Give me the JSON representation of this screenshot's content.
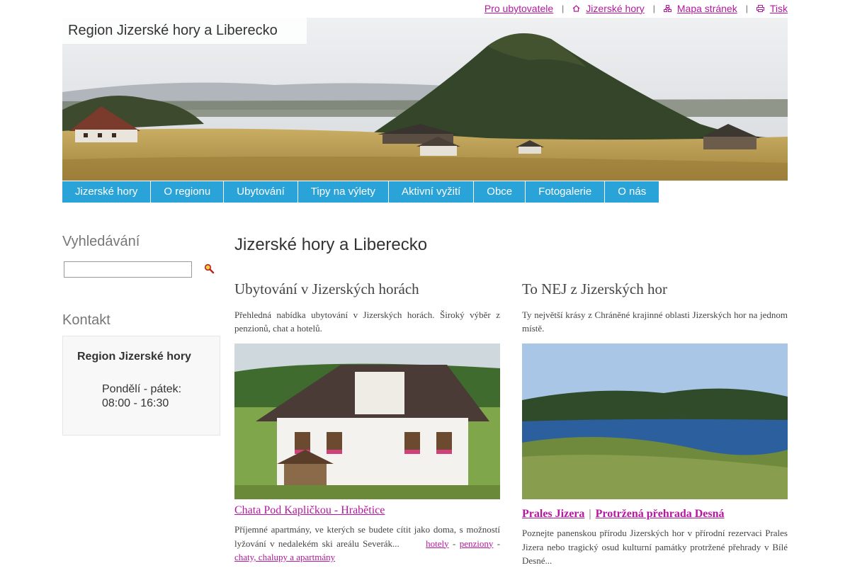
{
  "toplinks": {
    "for_owners": "Pro ubytovatele",
    "home": "Jizerské hory",
    "sitemap": "Mapa stránek",
    "print": "Tisk",
    "separator": "|"
  },
  "site_title": "Region Jizerské hory a Liberecko",
  "nav": [
    "Jizerské hory",
    "O regionu",
    "Ubytování",
    "Tipy na výlety",
    "Aktivní vyžití",
    "Obce",
    "Fotogalerie",
    "O nás"
  ],
  "sidebar": {
    "search_heading": "Vyhledávání",
    "search_value": "",
    "contact_heading": "Kontakt",
    "contact_org": "Region Jizerské hory",
    "contact_days": "Pondělí - pátek:",
    "contact_time": "08:00 - 16:30"
  },
  "main": {
    "title": "Jizerské hory a Liberecko",
    "left": {
      "heading": "Ubytování v Jizerských horách",
      "lead": "Přehledná nabídka ubytování v Jizerských horách. Široký výběr z penzionů, chat a hotelů.",
      "caption": "Chata Pod Kapličkou - Hrabětice",
      "desc": "Příjemné apartmány, ve kterých se budete cítit jako doma, s možností lyžování v nedalekém ski areálu Severák...",
      "link_hotels": "hotely",
      "link_pensions": "penziony",
      "link_cottages": "chaty, chalupy a apartmány",
      "dash": "-"
    },
    "right": {
      "heading": "To NEJ z Jizerských hor",
      "lead": "Ty největší krásy z Chráněné krajinné oblasti Jizerských hor na jednom místě.",
      "caption_a": "Prales Jizera",
      "caption_sep": "|",
      "caption_b": "Protržená přehrada Desná",
      "desc": "Poznejte panenskou přírodu Jizerských hor v přírodní rezervaci Prales Jizera nebo tragický osud kulturní památky protržené přehrady v Bílé Desné..."
    }
  },
  "colors": {
    "link": "#b5179e",
    "nav_bg": "#2aa3d8"
  }
}
